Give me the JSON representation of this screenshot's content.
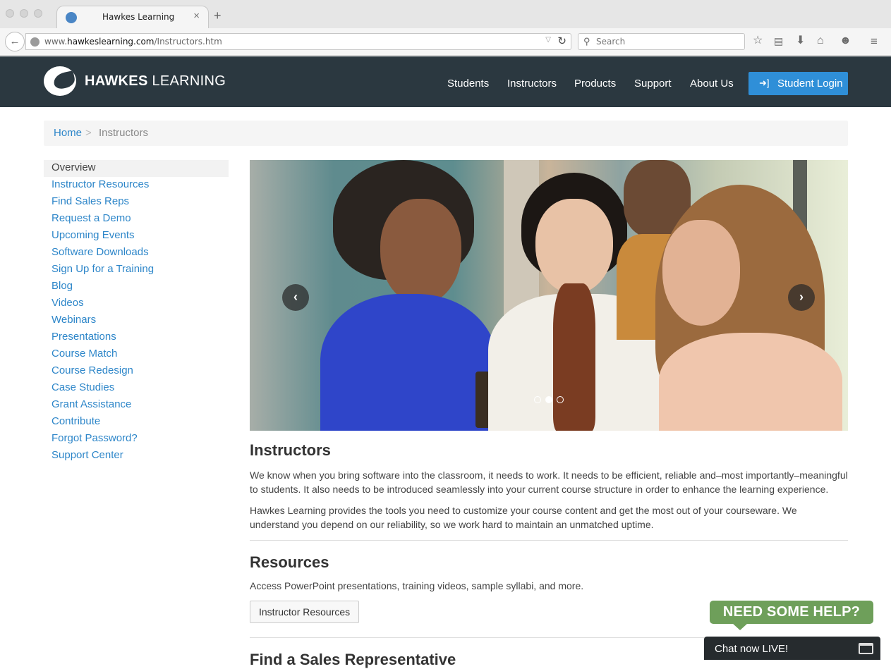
{
  "browser": {
    "tab_title": "Hawkes Learning",
    "url_prefix": "www.",
    "url_domain": "hawkeslearning.com",
    "url_path": "/Instructors.htm",
    "search_placeholder": "Search"
  },
  "header": {
    "logo_bold": "HAWKES",
    "logo_light": "LEARNING",
    "nav": [
      "Students",
      "Instructors",
      "Products",
      "Support",
      "About Us"
    ],
    "login_label": "Student Login"
  },
  "breadcrumb": {
    "home": "Home",
    "separator": ">",
    "current": "Instructors"
  },
  "sidebar": {
    "items": [
      "Overview",
      "Instructor Resources",
      "Find Sales Reps",
      "Request a Demo",
      "Upcoming Events",
      "Software Downloads",
      "Sign Up for a Training",
      "Blog",
      "Videos",
      "Webinars",
      "Presentations",
      "Course Match",
      "Course Redesign",
      "Case Studies",
      "Grant Assistance",
      "Contribute",
      "Forgot Password?",
      "Support Center"
    ],
    "active_index": 0
  },
  "carousel": {
    "slide_count": 3,
    "active_slide": 1,
    "prev_icon": "chevron-left-icon",
    "next_icon": "chevron-right-icon"
  },
  "main": {
    "title": "Instructors",
    "paragraph1": "We know when you bring software into the classroom, it needs to work. It needs to be efficient, reliable and–most importantly–meaningful to students. It also needs to be introduced seamlessly into your current course structure in order to enhance the learning experience.",
    "paragraph2": "Hawkes Learning provides the tools you need to customize your course content and get the most out of your courseware. We understand you depend on our reliability, so we work hard to maintain an unmatched uptime.",
    "resources_title": "Resources",
    "resources_text": "Access PowerPoint presentations, training videos, sample syllabi, and more.",
    "resources_button": "Instructor Resources",
    "next_section_title": "Find a Sales Representative"
  },
  "chat": {
    "bubble": "NEED SOME HELP?",
    "bar_label": "Chat now LIVE!"
  },
  "colors": {
    "header_bg": "#2b3840",
    "link": "#2d86c9",
    "login_button": "#2f8fd8",
    "help_green": "#6e9f5a"
  }
}
